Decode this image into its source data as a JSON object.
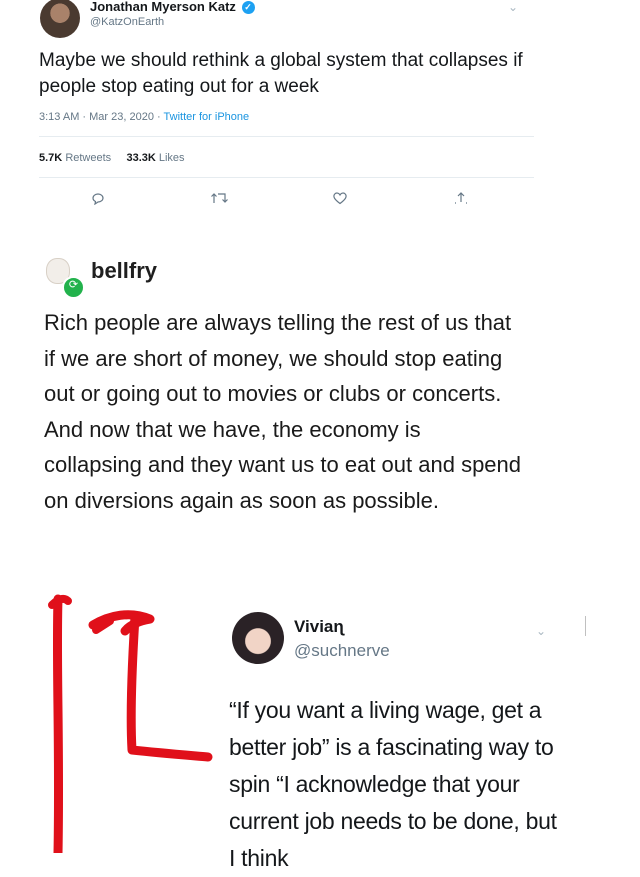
{
  "tweet1": {
    "author_name": "Jonathan Myerson Katz",
    "handle": "@KatzOnEarth",
    "text": "Maybe we should rethink a global system that collapses if people stop eating out for a week",
    "time": "3:13 AM · Mar 23, 2020",
    "separator": " · ",
    "source": "Twitter for iPhone",
    "retweets_count": "5.7K",
    "retweets_label": "Retweets",
    "likes_count": "33.3K",
    "likes_label": "Likes",
    "actions": {
      "reply_icon": "reply-icon",
      "retweet_icon": "retweet-icon",
      "like_icon": "heart-icon",
      "share_icon": "share-icon"
    }
  },
  "tumblr_post": {
    "username": "bellfry",
    "text": "Rich people are always telling the rest of us that if we are short of money, we should stop eating out or going out to movies or clubs or concerts. And now that we have, the economy is collapsing and they want us to eat out and spend on diversions again as soon as possible."
  },
  "tweet2": {
    "author_name": "Viviaɳ",
    "handle": "@suchnerve",
    "text": "“If you want a living wage, get a better job” is a fascinating way to spin “I acknowledge that your current job needs to be done, but I think"
  },
  "colors": {
    "twitter_blue": "#1da1f2",
    "reblog_green": "#22b24c",
    "annotation_red": "#e0101a"
  }
}
